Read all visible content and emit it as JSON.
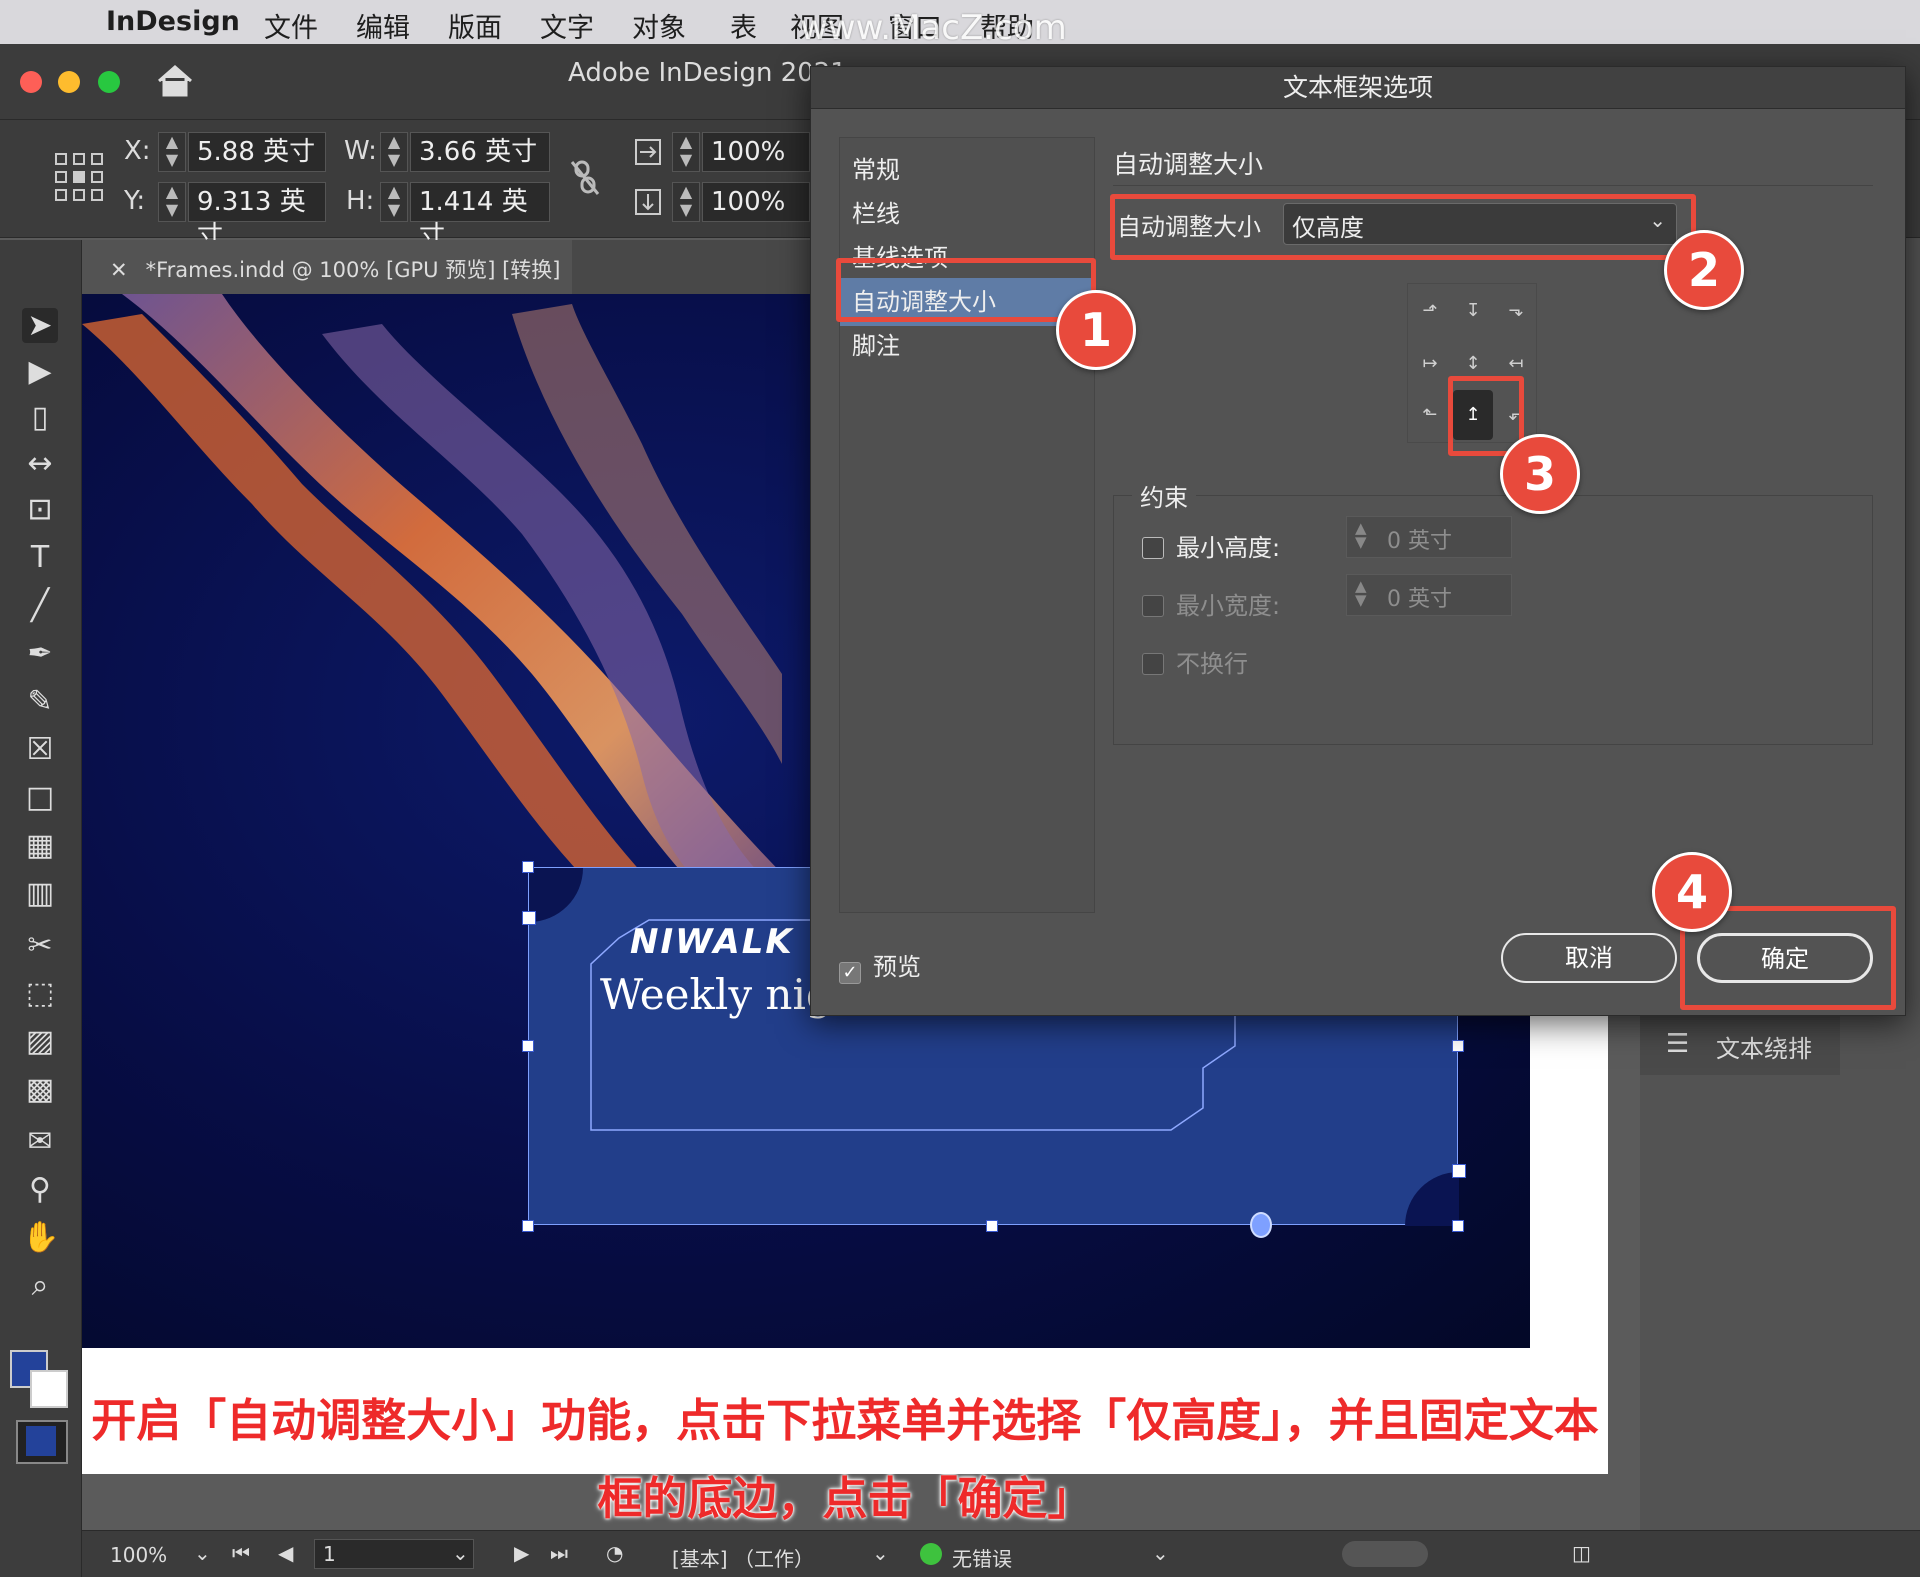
{
  "menubar": {
    "app": "InDesign",
    "items": [
      "文件",
      "编辑",
      "版面",
      "文字",
      "对象",
      "表",
      "视图",
      "窗口",
      "帮助"
    ],
    "watermark": "www.MacZ.com"
  },
  "window": {
    "title": "Adobe InDesign 2021"
  },
  "control": {
    "x_label": "X:",
    "x_value": "5.88 英寸",
    "y_label": "Y:",
    "y_value": "9.313 英寸",
    "w_label": "W:",
    "w_value": "3.66 英寸",
    "h_label": "H:",
    "h_value": "1.414 英寸",
    "scale_x": "100%",
    "scale_y": "100%"
  },
  "document_tab": {
    "title": "*Frames.indd @ 100% [GPU 预览] [转换]"
  },
  "card": {
    "title": "NIWALK",
    "subtitle": "Weekly nig"
  },
  "panel": {
    "text_wrap": "文本绕排"
  },
  "status": {
    "zoom": "100%",
    "page": "1",
    "profile": "[基本] （工作）",
    "preflight": "无错误",
    "preflight_color": "#3ec23e"
  },
  "caption": {
    "line1": "开启「自动调整大小」功能，点击下拉菜单并选择「仅高度」，并且固定文本",
    "line2": "框的底边，点击「确定」"
  },
  "dialog": {
    "title": "文本框架选项",
    "sidebar": [
      "常规",
      "栏线",
      "基线选项",
      "自动调整大小",
      "脚注"
    ],
    "selected_index": 3,
    "section_title": "自动调整大小",
    "autosize_label": "自动调整大小",
    "autosize_value": "仅高度",
    "constraints": {
      "legend": "约束",
      "min_height_label": "最小高度:",
      "min_height_value": "0 英寸",
      "min_width_label": "最小宽度:",
      "min_width_value": "0 英寸",
      "no_wrap_label": "不换行"
    },
    "preview_label": "预览",
    "preview_checked": true,
    "cancel": "取消",
    "ok": "确定"
  },
  "annotations": {
    "steps": [
      "1",
      "2",
      "3",
      "4"
    ],
    "color": "#e84a3c"
  }
}
